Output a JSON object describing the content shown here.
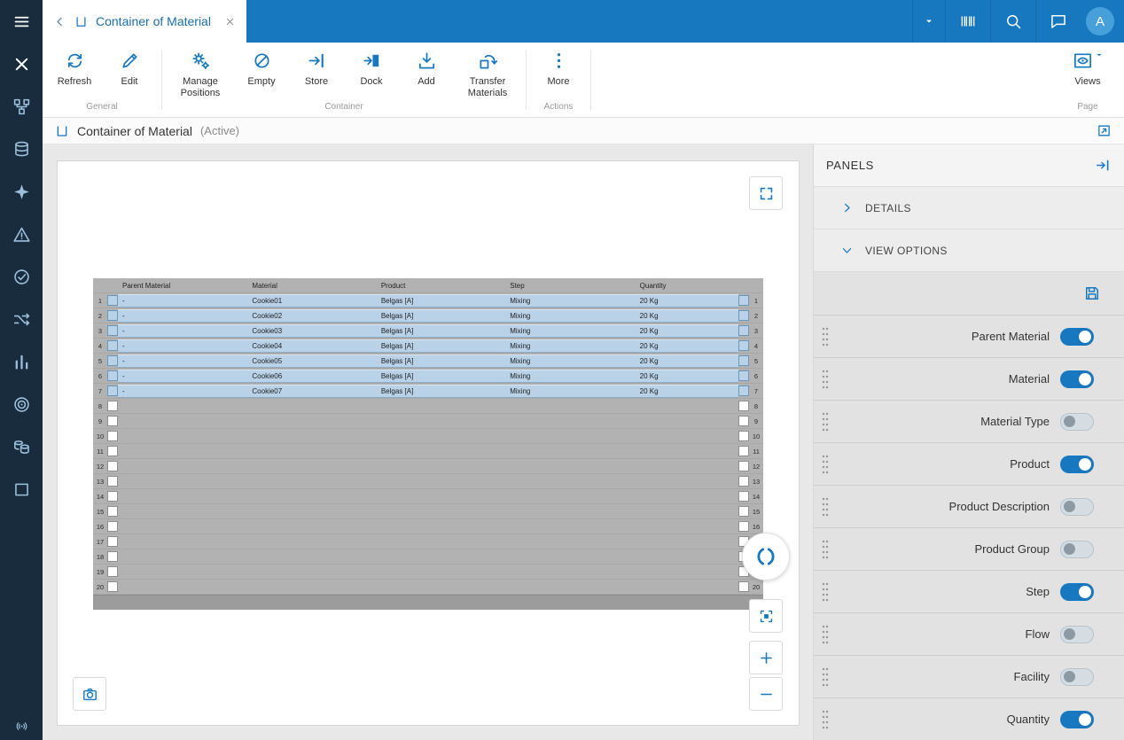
{
  "colors": {
    "accent": "#1878bf",
    "sidebar_bg": "#182c3d",
    "topbar_bg": "#1878bf",
    "toggle_on": "#1878bf",
    "row_highlight": "#b9d2e8"
  },
  "sidebar": {
    "items": [
      "hamburger-menu-icon",
      "x-logo-icon",
      "modeling-icon",
      "stack-icon",
      "dispatch-icon",
      "alarm-icon",
      "quality-icon",
      "flow-icon",
      "analytics-icon",
      "target-icon",
      "data-store-icon",
      "container-app-icon"
    ],
    "bottom_item": "broadcast-icon"
  },
  "topbar": {
    "tab_title": "Container of Material",
    "avatar_initial": "A"
  },
  "ribbon": {
    "groups": [
      {
        "caption": "General",
        "buttons": [
          {
            "label": "Refresh",
            "icon": "refresh-icon"
          },
          {
            "label": "Edit",
            "icon": "edit-icon"
          }
        ]
      },
      {
        "caption": "Container",
        "buttons": [
          {
            "label": "Manage Positions",
            "icon": "manage-positions-icon"
          },
          {
            "label": "Empty",
            "icon": "empty-icon"
          },
          {
            "label": "Store",
            "icon": "store-icon"
          },
          {
            "label": "Dock",
            "icon": "dock-icon"
          },
          {
            "label": "Add",
            "icon": "add-icon"
          },
          {
            "label": "Transfer Materials",
            "icon": "transfer-materials-icon"
          }
        ]
      },
      {
        "caption": "Actions",
        "buttons": [
          {
            "label": "More",
            "icon": "more-icon"
          }
        ]
      }
    ],
    "page_group": {
      "caption": "Page",
      "views_label": "Views"
    }
  },
  "page_header": {
    "title": "Container of Material",
    "status": "(Active)"
  },
  "container_viz": {
    "columns": [
      "Parent Material",
      "Material",
      "Product",
      "Step",
      "Quantity"
    ],
    "position_count": 20,
    "rows": [
      {
        "position": 1,
        "parent_material": "-",
        "material": "Cookie01",
        "product": "Belgas [A]",
        "step": "Mixing",
        "quantity": "20 Kg"
      },
      {
        "position": 2,
        "parent_material": "-",
        "material": "Cookie02",
        "product": "Belgas [A]",
        "step": "Mixing",
        "quantity": "20 Kg"
      },
      {
        "position": 3,
        "parent_material": "-",
        "material": "Cookie03",
        "product": "Belgas [A]",
        "step": "Mixing",
        "quantity": "20 Kg"
      },
      {
        "position": 4,
        "parent_material": "-",
        "material": "Cookie04",
        "product": "Belgas [A]",
        "step": "Mixing",
        "quantity": "20 Kg"
      },
      {
        "position": 5,
        "parent_material": "-",
        "material": "Cookie05",
        "product": "Belgas [A]",
        "step": "Mixing",
        "quantity": "20 Kg"
      },
      {
        "position": 6,
        "parent_material": "-",
        "material": "Cookie06",
        "product": "Belgas [A]",
        "step": "Mixing",
        "quantity": "20 Kg"
      },
      {
        "position": 7,
        "parent_material": "-",
        "material": "Cookie07",
        "product": "Belgas [A]",
        "step": "Mixing",
        "quantity": "20 Kg"
      }
    ]
  },
  "panels": {
    "title": "PANELS",
    "details_label": "DETAILS",
    "view_options_label": "VIEW OPTIONS",
    "view_options": [
      {
        "label": "Parent Material",
        "enabled": true
      },
      {
        "label": "Material",
        "enabled": true
      },
      {
        "label": "Material Type",
        "enabled": false
      },
      {
        "label": "Product",
        "enabled": true
      },
      {
        "label": "Product Description",
        "enabled": false
      },
      {
        "label": "Product Group",
        "enabled": false
      },
      {
        "label": "Step",
        "enabled": true
      },
      {
        "label": "Flow",
        "enabled": false
      },
      {
        "label": "Facility",
        "enabled": false
      },
      {
        "label": "Quantity",
        "enabled": true
      }
    ]
  }
}
